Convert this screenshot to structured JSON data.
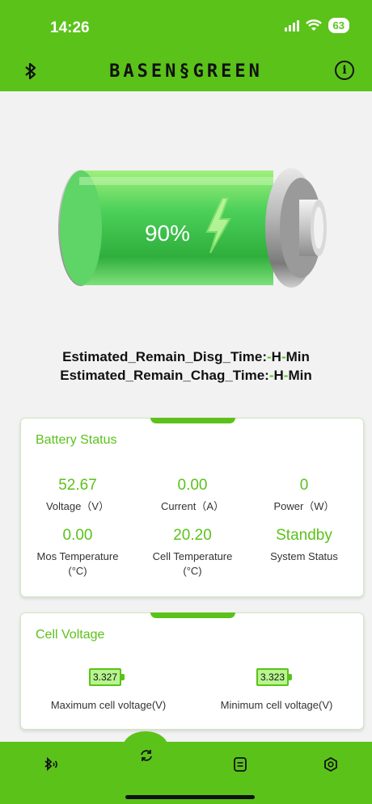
{
  "status_bar": {
    "time": "14:26",
    "battery_level": "63"
  },
  "header": {
    "brand": "BASEN§GREEN",
    "bluetooth_icon": "bluetooth-icon",
    "info_icon": "info-icon"
  },
  "battery": {
    "percent_label": "90%",
    "level": 0.9,
    "charging_icon": "lightning-icon"
  },
  "estimates": {
    "disg_label": "Estimated_Remain_Disg_Time:",
    "chag_label": "Estimated_Remain_Chag_Time:",
    "dash": "-",
    "h": "H",
    "min": "Min"
  },
  "battery_status": {
    "title": "Battery Status",
    "stats": [
      {
        "value": "52.67",
        "label": "Voltage（V）"
      },
      {
        "value": "0.00",
        "label": "Current（A）"
      },
      {
        "value": "0",
        "label": "Power（W）"
      },
      {
        "value": "0.00",
        "label": "Mos Temperature\n(°C)"
      },
      {
        "value": "20.20",
        "label": "Cell Temperature\n(°C)"
      },
      {
        "value": "Standby",
        "label": "System Status"
      }
    ]
  },
  "cell_voltage": {
    "title": "Cell Voltage",
    "max_value": "3.327",
    "max_label": "Maximum cell voltage(V)",
    "min_value": "3.323",
    "min_label": "Minimum cell voltage(V)"
  },
  "bottom_nav": {
    "items": [
      "bluetooth-scan-icon",
      "refresh-icon",
      "document-icon",
      "settings-icon"
    ]
  },
  "colors": {
    "accent": "#5bc21a",
    "cell_fill": "#b7f58e"
  }
}
